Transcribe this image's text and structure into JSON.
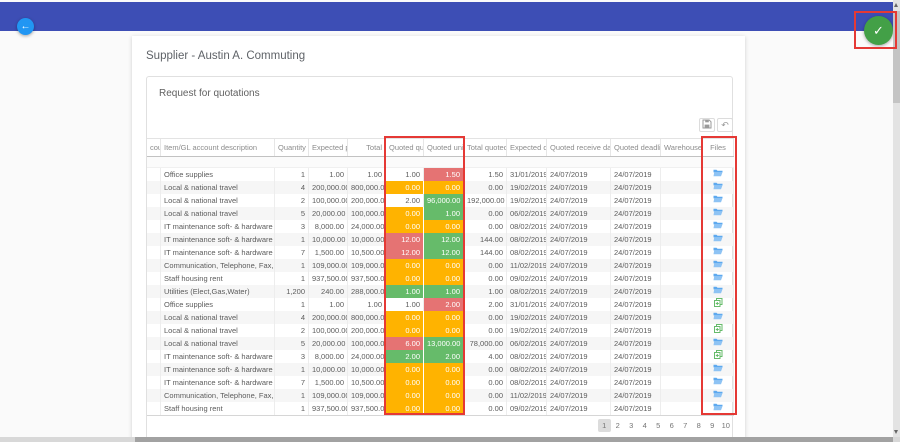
{
  "colors": {
    "topbar": "#3d4eb5",
    "back_button": "#2196f3",
    "confirm_button": "#43a047",
    "annotation": "#e53935",
    "amber_cell": "#ffb300",
    "red_cell": "#e57373",
    "green_cell": "#66bb6a",
    "file_folder_blue": "#5da9ef",
    "file_copy_green": "#66bb6a"
  },
  "header": {
    "back_icon": "←",
    "confirm_icon": "✓"
  },
  "page": {
    "title": "Supplier - Austin A. Commuting"
  },
  "panel": {
    "title": "Request for quotations"
  },
  "toolbar": {
    "save_icon": "floppy-disk",
    "undo_icon": "↶"
  },
  "table": {
    "columns": [
      "count",
      "Item/GL account description",
      "Quantity",
      "Expected pr...",
      "Total",
      "Quoted qua...",
      "Quoted uni...",
      "Total quoted",
      "Expected date",
      "Quoted receive date",
      "Quoted deadline",
      "Warehouse",
      "Files"
    ],
    "rows": [
      {
        "acct": "",
        "desc": "Office supplies",
        "qty": "1",
        "exp_price": "1.00",
        "total": "1.00",
        "q_qty": "1.00",
        "q_qty_bg": "none",
        "q_unit": "1.50",
        "q_unit_bg": "red",
        "total_quoted": "1.50",
        "exp_date": "31/01/2019",
        "recv_date": "24/07/2019",
        "deadline": "24/07/2019",
        "warehouse": "",
        "file_icon": "folder-open"
      },
      {
        "acct": "",
        "desc": "Local & national travel",
        "qty": "4",
        "exp_price": "200,000.00",
        "total": "800,000.00",
        "q_qty": "0.00",
        "q_qty_bg": "amber",
        "q_unit": "0.00",
        "q_unit_bg": "amber",
        "total_quoted": "0.00",
        "exp_date": "19/02/2019",
        "recv_date": "24/07/2019",
        "deadline": "24/07/2019",
        "warehouse": "",
        "file_icon": "folder-open"
      },
      {
        "acct": "",
        "desc": "Local & national travel",
        "qty": "2",
        "exp_price": "100,000.00",
        "total": "200,000.00",
        "q_qty": "2.00",
        "q_qty_bg": "none",
        "q_unit": "96,000.00",
        "q_unit_bg": "green",
        "total_quoted": "192,000.00",
        "exp_date": "19/02/2019",
        "recv_date": "24/07/2019",
        "deadline": "24/07/2019",
        "warehouse": "",
        "file_icon": "folder-open"
      },
      {
        "acct": "",
        "desc": "Local & national travel",
        "qty": "5",
        "exp_price": "20,000.00",
        "total": "100,000.00",
        "q_qty": "0.00",
        "q_qty_bg": "amber",
        "q_unit": "1.00",
        "q_unit_bg": "green",
        "total_quoted": "0.00",
        "exp_date": "06/02/2019",
        "recv_date": "24/07/2019",
        "deadline": "24/07/2019",
        "warehouse": "",
        "file_icon": "folder-open"
      },
      {
        "acct": "",
        "desc": "IT maintenance soft- & hardware",
        "qty": "3",
        "exp_price": "8,000.00",
        "total": "24,000.00",
        "q_qty": "0.00",
        "q_qty_bg": "amber",
        "q_unit": "0.00",
        "q_unit_bg": "amber",
        "total_quoted": "0.00",
        "exp_date": "08/02/2019",
        "recv_date": "24/07/2019",
        "deadline": "24/07/2019",
        "warehouse": "",
        "file_icon": "folder-open"
      },
      {
        "acct": "",
        "desc": "IT maintenance soft- & hardware",
        "qty": "1",
        "exp_price": "10,000.00",
        "total": "10,000.00",
        "q_qty": "12.00",
        "q_qty_bg": "red",
        "q_unit": "12.00",
        "q_unit_bg": "green",
        "total_quoted": "144.00",
        "exp_date": "08/02/2019",
        "recv_date": "24/07/2019",
        "deadline": "24/07/2019",
        "warehouse": "",
        "file_icon": "folder-open"
      },
      {
        "acct": "",
        "desc": "IT maintenance soft- & hardware",
        "qty": "7",
        "exp_price": "1,500.00",
        "total": "10,500.00",
        "q_qty": "12.00",
        "q_qty_bg": "red",
        "q_unit": "12.00",
        "q_unit_bg": "green",
        "total_quoted": "144.00",
        "exp_date": "08/02/2019",
        "recv_date": "24/07/2019",
        "deadline": "24/07/2019",
        "warehouse": "",
        "file_icon": "folder-open"
      },
      {
        "acct": "",
        "desc": "Communication, Telephone, Fax, Int.",
        "qty": "1",
        "exp_price": "109,000.00",
        "total": "109,000.00",
        "q_qty": "0.00",
        "q_qty_bg": "amber",
        "q_unit": "0.00",
        "q_unit_bg": "amber",
        "total_quoted": "0.00",
        "exp_date": "11/02/2019",
        "recv_date": "24/07/2019",
        "deadline": "24/07/2019",
        "warehouse": "",
        "file_icon": "folder-open"
      },
      {
        "acct": "",
        "desc": "Staff housing rent",
        "qty": "1",
        "exp_price": "937,500.00",
        "total": "937,500.00",
        "q_qty": "0.00",
        "q_qty_bg": "amber",
        "q_unit": "0.00",
        "q_unit_bg": "amber",
        "total_quoted": "0.00",
        "exp_date": "09/02/2019",
        "recv_date": "24/07/2019",
        "deadline": "24/07/2019",
        "warehouse": "",
        "file_icon": "folder-open"
      },
      {
        "acct": "",
        "desc": "Utilities (Elect,Gas,Water)",
        "qty": "1,200",
        "exp_price": "240.00",
        "total": "288,000.00",
        "q_qty": "1.00",
        "q_qty_bg": "green",
        "q_unit": "1.00",
        "q_unit_bg": "green",
        "total_quoted": "1.00",
        "exp_date": "08/02/2019",
        "recv_date": "24/07/2019",
        "deadline": "24/07/2019",
        "warehouse": "",
        "file_icon": "folder-open"
      },
      {
        "acct": "",
        "desc": "Office supplies",
        "qty": "1",
        "exp_price": "1.00",
        "total": "1.00",
        "q_qty": "1.00",
        "q_qty_bg": "none",
        "q_unit": "2.00",
        "q_unit_bg": "red",
        "total_quoted": "2.00",
        "exp_date": "31/01/2019",
        "recv_date": "24/07/2019",
        "deadline": "24/07/2019",
        "warehouse": "",
        "file_icon": "file-copy"
      },
      {
        "acct": "",
        "desc": "Local & national travel",
        "qty": "4",
        "exp_price": "200,000.00",
        "total": "800,000.00",
        "q_qty": "0.00",
        "q_qty_bg": "amber",
        "q_unit": "0.00",
        "q_unit_bg": "amber",
        "total_quoted": "0.00",
        "exp_date": "19/02/2019",
        "recv_date": "24/07/2019",
        "deadline": "24/07/2019",
        "warehouse": "",
        "file_icon": "folder-open"
      },
      {
        "acct": "",
        "desc": "Local & national travel",
        "qty": "2",
        "exp_price": "100,000.00",
        "total": "200,000.00",
        "q_qty": "0.00",
        "q_qty_bg": "amber",
        "q_unit": "0.00",
        "q_unit_bg": "amber",
        "total_quoted": "0.00",
        "exp_date": "19/02/2019",
        "recv_date": "24/07/2019",
        "deadline": "24/07/2019",
        "warehouse": "",
        "file_icon": "file-copy"
      },
      {
        "acct": "",
        "desc": "Local & national travel",
        "qty": "5",
        "exp_price": "20,000.00",
        "total": "100,000.00",
        "q_qty": "6.00",
        "q_qty_bg": "red",
        "q_unit": "13,000.00",
        "q_unit_bg": "green",
        "total_quoted": "78,000.00",
        "exp_date": "06/02/2019",
        "recv_date": "24/07/2019",
        "deadline": "24/07/2019",
        "warehouse": "",
        "file_icon": "folder-open"
      },
      {
        "acct": "",
        "desc": "IT maintenance soft- & hardware",
        "qty": "3",
        "exp_price": "8,000.00",
        "total": "24,000.00",
        "q_qty": "2.00",
        "q_qty_bg": "green",
        "q_unit": "2.00",
        "q_unit_bg": "green",
        "total_quoted": "4.00",
        "exp_date": "08/02/2019",
        "recv_date": "24/07/2019",
        "deadline": "24/07/2019",
        "warehouse": "",
        "file_icon": "file-copy"
      },
      {
        "acct": "",
        "desc": "IT maintenance soft- & hardware",
        "qty": "1",
        "exp_price": "10,000.00",
        "total": "10,000.00",
        "q_qty": "0.00",
        "q_qty_bg": "amber",
        "q_unit": "0.00",
        "q_unit_bg": "amber",
        "total_quoted": "0.00",
        "exp_date": "08/02/2019",
        "recv_date": "24/07/2019",
        "deadline": "24/07/2019",
        "warehouse": "",
        "file_icon": "folder-open"
      },
      {
        "acct": "",
        "desc": "IT maintenance soft- & hardware",
        "qty": "7",
        "exp_price": "1,500.00",
        "total": "10,500.00",
        "q_qty": "0.00",
        "q_qty_bg": "amber",
        "q_unit": "0.00",
        "q_unit_bg": "amber",
        "total_quoted": "0.00",
        "exp_date": "08/02/2019",
        "recv_date": "24/07/2019",
        "deadline": "24/07/2019",
        "warehouse": "",
        "file_icon": "folder-open"
      },
      {
        "acct": "",
        "desc": "Communication, Telephone, Fax, Int.",
        "qty": "1",
        "exp_price": "109,000.00",
        "total": "109,000.00",
        "q_qty": "0.00",
        "q_qty_bg": "amber",
        "q_unit": "0.00",
        "q_unit_bg": "amber",
        "total_quoted": "0.00",
        "exp_date": "11/02/2019",
        "recv_date": "24/07/2019",
        "deadline": "24/07/2019",
        "warehouse": "",
        "file_icon": "folder-open"
      },
      {
        "acct": "",
        "desc": "Staff housing rent",
        "qty": "1",
        "exp_price": "937,500.00",
        "total": "937,500.00",
        "q_qty": "0.00",
        "q_qty_bg": "amber",
        "q_unit": "0.00",
        "q_unit_bg": "amber",
        "total_quoted": "0.00",
        "exp_date": "09/02/2019",
        "recv_date": "24/07/2019",
        "deadline": "24/07/2019",
        "warehouse": "",
        "file_icon": "folder-open"
      }
    ]
  },
  "pagination": {
    "pages": [
      "1",
      "2",
      "3",
      "4",
      "5",
      "6",
      "7",
      "8",
      "9",
      "10"
    ],
    "active": "1"
  }
}
